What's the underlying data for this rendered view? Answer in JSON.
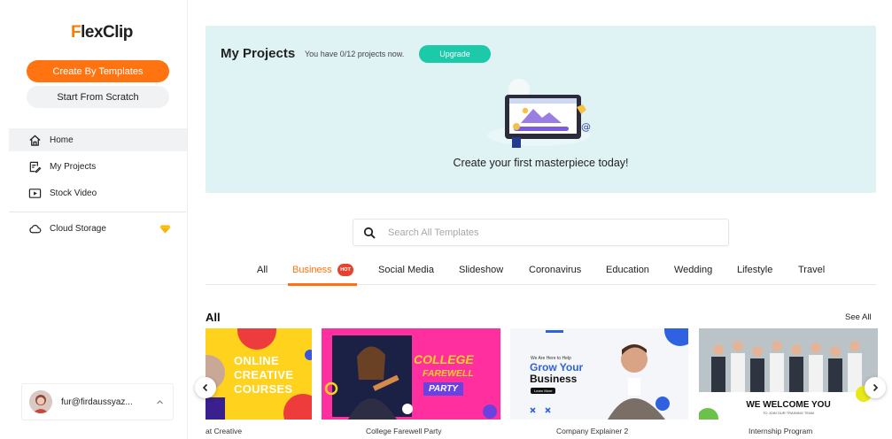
{
  "brand": {
    "logo_text_prefix": "F",
    "logo_text_rest": "lexClip"
  },
  "sidebar": {
    "create_templates_label": "Create By Templates",
    "start_scratch_label": "Start From Scratch",
    "items": [
      {
        "label": "Home",
        "icon": "home-icon"
      },
      {
        "label": "My Projects",
        "icon": "edit-icon"
      },
      {
        "label": "Stock Video",
        "icon": "video-icon"
      }
    ],
    "cloud_storage_label": "Cloud Storage",
    "user_email": "fur@firdaussyaz..."
  },
  "projects": {
    "title": "My Projects",
    "count_text": "You have 0/12 projects now.",
    "upgrade_label": "Upgrade",
    "cta_text": "Create your first masterpiece today!"
  },
  "search": {
    "placeholder": "Search All Templates"
  },
  "tabs": [
    {
      "label": "All"
    },
    {
      "label": "Business",
      "badge": "HOT"
    },
    {
      "label": "Social Media"
    },
    {
      "label": "Slideshow"
    },
    {
      "label": "Coronavirus"
    },
    {
      "label": "Education"
    },
    {
      "label": "Wedding"
    },
    {
      "label": "Lifestyle"
    },
    {
      "label": "Travel"
    }
  ],
  "templates_section": {
    "title": "All",
    "see_all_label": "See All",
    "cards": [
      {
        "label": "at Creative",
        "overlay_text_1": "ONLINE",
        "overlay_text_2": "CREATIVE",
        "overlay_text_3": "COURSES"
      },
      {
        "label": "College Farewell Party",
        "overlay_text_1": "COLLEGE",
        "overlay_text_2": "FAREWELL",
        "overlay_text_3": "PARTY"
      },
      {
        "label": "Company Explainer 2",
        "overlay_small": "We Are Here to Help",
        "overlay_text_1": "Grow Your",
        "overlay_text_2": "Business",
        "overlay_btn": "Learn More"
      },
      {
        "label": "Internship Program",
        "overlay_text_1": "WE WELCOME YOU",
        "overlay_small": "TO JOIN OUR TRAINING TEAM"
      }
    ]
  },
  "colors": {
    "accent": "#ff7410",
    "teal": "#1cc9a8",
    "panel_bg": "#dff2f4"
  }
}
